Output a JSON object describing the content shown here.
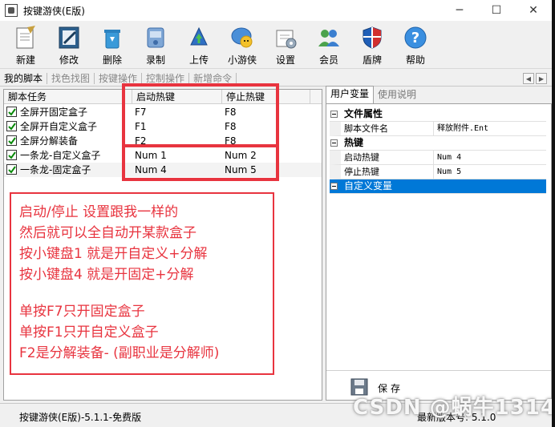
{
  "window": {
    "title": "按键游侠(E版)"
  },
  "toolbar": {
    "new": "新建",
    "edit": "修改",
    "delete": "删除",
    "record": "录制",
    "upload": "上传",
    "xiaoyouxia": "小游侠",
    "settings": "设置",
    "member": "会员",
    "shield": "盾牌",
    "help": "帮助"
  },
  "tabs": [
    "我的脚本",
    "找色找图",
    "按键操作",
    "控制操作",
    "新增命令"
  ],
  "left": {
    "headers": {
      "task": "脚本任务",
      "start": "启动热键",
      "stop": "停止热键"
    },
    "rows": [
      {
        "name": "全屏开固定盒子",
        "start": "F7",
        "stop": "F8"
      },
      {
        "name": "全屏开自定义盒子",
        "start": "F1",
        "stop": "F8"
      },
      {
        "name": "全屏分解装备",
        "start": "F2",
        "stop": "F8"
      },
      {
        "name": "一条龙-自定义盒子",
        "start": "Num 1",
        "stop": "Num 2"
      },
      {
        "name": "一条龙-固定盒子",
        "start": "Num 4",
        "stop": "Num 5"
      }
    ]
  },
  "right": {
    "tabs": [
      "用户变量",
      "使用说明"
    ],
    "cat_file": "文件属性",
    "file_name_label": "脚本文件名",
    "file_name_value": "释放附件.Ent",
    "cat_hotkey": "热键",
    "start_label": "启动热键",
    "start_value": "Num 4",
    "stop_label": "停止热键",
    "stop_value": "Num 5",
    "cat_custom": "自定义变量",
    "save": "保存"
  },
  "note": {
    "lines": [
      "启动/停止 设置跟我一样的",
      "然后就可以全自动开某款盒子",
      "按小键盘1  就是开自定义+分解",
      "按小键盘4  就是开固定+分解",
      "",
      "单按F7只开固定盒子",
      "单按F1只开自定义盒子",
      "F2是分解装备-  (副职业是分解师)"
    ]
  },
  "status": {
    "left": "按键游侠(E版)-5.1.1-免费版",
    "right": "最新版本号: 5.1.0"
  },
  "watermark": "CSDN @蜗牛1314",
  "colors": {
    "annotation": "#e8343f",
    "selection": "#0078d7"
  }
}
